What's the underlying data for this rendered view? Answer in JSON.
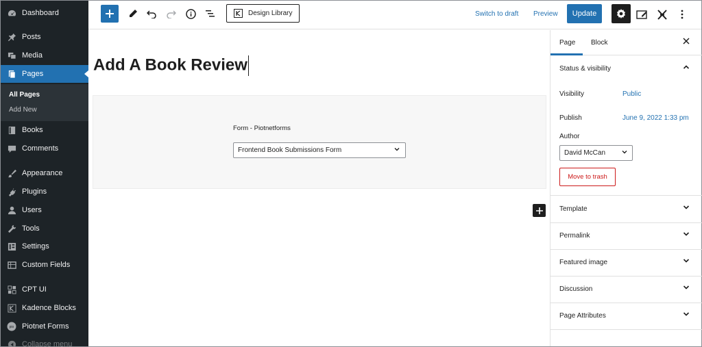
{
  "sidebar": {
    "items": [
      {
        "label": "Dashboard",
        "icon": "dashboard-icon"
      },
      {
        "label": "Posts",
        "icon": "pin-icon"
      },
      {
        "label": "Media",
        "icon": "media-icon"
      },
      {
        "label": "Pages",
        "icon": "pages-icon"
      },
      {
        "label": "Books",
        "icon": "book-icon"
      },
      {
        "label": "Comments",
        "icon": "comment-icon"
      },
      {
        "label": "Appearance",
        "icon": "brush-icon"
      },
      {
        "label": "Plugins",
        "icon": "plug-icon"
      },
      {
        "label": "Users",
        "icon": "user-icon"
      },
      {
        "label": "Tools",
        "icon": "wrench-icon"
      },
      {
        "label": "Settings",
        "icon": "settings-icon"
      },
      {
        "label": "Custom Fields",
        "icon": "table-icon"
      },
      {
        "label": "CPT UI",
        "icon": "grid-icon"
      },
      {
        "label": "Kadence Blocks",
        "icon": "kadence-icon"
      },
      {
        "label": "Piotnet Forms",
        "icon": "piotnet-icon"
      },
      {
        "label": "Collapse menu",
        "icon": "collapse-icon"
      }
    ],
    "submenu": {
      "all_pages": "All Pages",
      "add_new": "Add New"
    }
  },
  "toolbar": {
    "design_library": "Design Library",
    "switch_to_draft": "Switch to draft",
    "preview": "Preview",
    "update": "Update"
  },
  "editor": {
    "title": "Add A Book Review",
    "form_block_label": "Form - Piotnetforms",
    "form_select_value": "Frontend Book Submissions Form"
  },
  "panel": {
    "tab_page": "Page",
    "tab_block": "Block",
    "status_visibility": "Status & visibility",
    "visibility_label": "Visibility",
    "visibility_value": "Public",
    "publish_label": "Publish",
    "publish_value": "June 9, 2022 1:33 pm",
    "author_label": "Author",
    "author_value": "David McCan",
    "move_to_trash": "Move to trash",
    "sections": [
      "Template",
      "Permalink",
      "Featured image",
      "Discussion",
      "Page Attributes"
    ]
  },
  "colors": {
    "accent": "#2271b1",
    "sidebar_bg": "#1d2327",
    "danger": "#cc1818"
  }
}
